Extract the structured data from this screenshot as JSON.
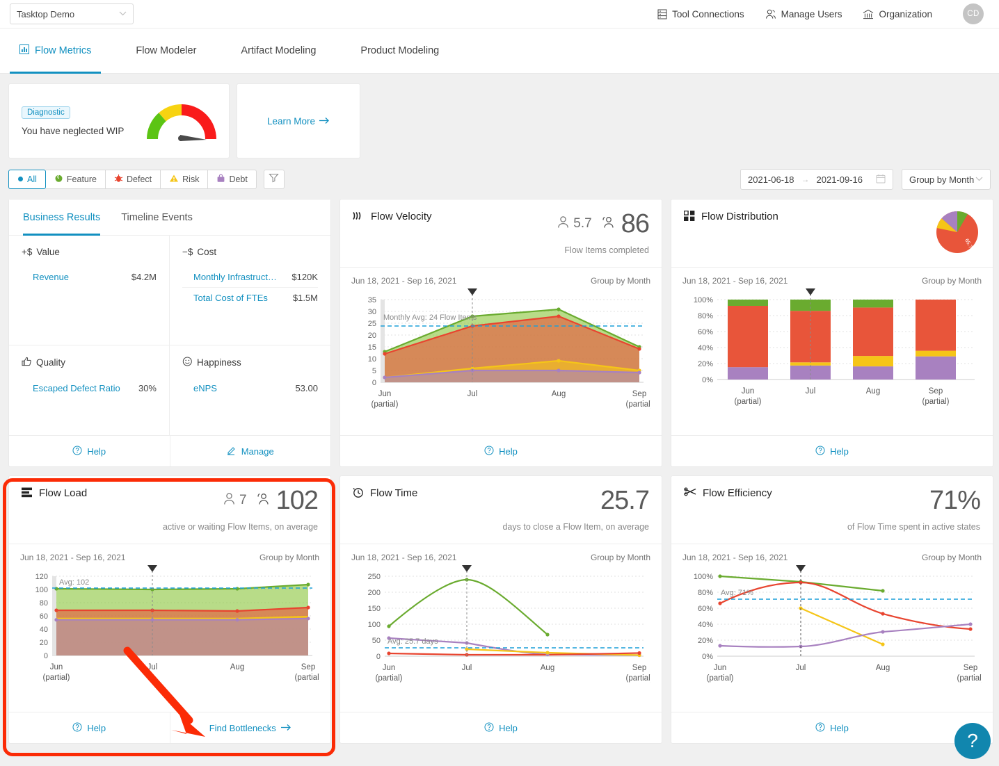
{
  "topbar": {
    "org_selector_value": "Tasktop Demo",
    "nav": [
      {
        "label": "Tool Connections",
        "icon": "list-icon"
      },
      {
        "label": "Manage Users",
        "icon": "users-icon"
      },
      {
        "label": "Organization",
        "icon": "bank-icon"
      }
    ],
    "avatar_initials": "CD"
  },
  "tabs": [
    {
      "label": "Flow Metrics",
      "icon": "bar-chart-icon",
      "active": true
    },
    {
      "label": "Flow Modeler",
      "active": false
    },
    {
      "label": "Artifact Modeling",
      "active": false
    },
    {
      "label": "Product Modeling",
      "active": false
    }
  ],
  "diagnostic": {
    "badge": "Diagnostic",
    "message": "You have neglected WIP",
    "gauge_value_pct": 88,
    "learn_more": "Learn More"
  },
  "filters": {
    "pills": [
      {
        "label": "All",
        "icon": "dot-icon",
        "selected": true,
        "color": "#1290c0"
      },
      {
        "label": "Feature",
        "icon": "feature-icon",
        "selected": false,
        "color": "#6aab2f"
      },
      {
        "label": "Defect",
        "icon": "defect-icon",
        "selected": false,
        "color": "#e8442f"
      },
      {
        "label": "Risk",
        "icon": "risk-icon",
        "selected": false,
        "color": "#f5c518"
      },
      {
        "label": "Debt",
        "icon": "debt-icon",
        "selected": false,
        "color": "#a881c0"
      }
    ],
    "funnel_icon": "filter-icon",
    "date_start": "2021-06-18",
    "date_end": "2021-09-16",
    "date_arrow": "→",
    "calendar_icon": "calendar-icon",
    "group_by": "Group by Month"
  },
  "business_results": {
    "tabs": [
      {
        "label": "Business Results",
        "active": true
      },
      {
        "label": "Timeline Events",
        "active": false
      }
    ],
    "quadrants": [
      {
        "title": "Value",
        "title_prefix": "+$",
        "icon": "plus-dollar-icon",
        "rows": [
          {
            "label": "Revenue",
            "value": "$4.2M"
          }
        ]
      },
      {
        "title": "Cost",
        "title_prefix": "−$",
        "icon": "minus-dollar-icon",
        "rows": [
          {
            "label": "Monthly Infrastruct…",
            "value": "$120K"
          },
          {
            "label": "Total Cost of FTEs",
            "value": "$1.5M"
          }
        ]
      },
      {
        "title": "Quality",
        "title_prefix": "",
        "icon": "thumbs-up-icon",
        "rows": [
          {
            "label": "Escaped Defect Ratio",
            "value": "30%"
          }
        ]
      },
      {
        "title": "Happiness",
        "title_prefix": "",
        "icon": "smiley-icon",
        "rows": [
          {
            "label": "eNPS",
            "value": "53.00"
          }
        ]
      }
    ],
    "footer": [
      {
        "label": "Help",
        "icon": "help-icon"
      },
      {
        "label": "Manage",
        "icon": "pencil-icon"
      }
    ]
  },
  "cards": {
    "flow_velocity": {
      "title": "Flow Velocity",
      "icon": "velocity-icon",
      "stat_small": "5.7",
      "stat_small_icon": "person-icon",
      "stat_big": "86",
      "stat_big_icon": "people-icon",
      "subtitle": "Flow Items completed",
      "date_range": "Jun 18, 2021 - Sep 16, 2021",
      "group_by": "Group by Month",
      "footer": [
        {
          "label": "Help",
          "icon": "help-icon"
        }
      ]
    },
    "flow_distribution": {
      "title": "Flow Distribution",
      "icon": "distribution-icon",
      "date_range": "Jun 18, 2021 - Sep 16, 2021",
      "group_by": "Group by Month",
      "pie_label": "65.7%",
      "footer": [
        {
          "label": "Help",
          "icon": "help-icon"
        }
      ]
    },
    "flow_load": {
      "title": "Flow Load",
      "icon": "load-icon",
      "stat_small": "7",
      "stat_small_icon": "person-icon",
      "stat_big": "102",
      "stat_big_icon": "people-icon",
      "subtitle": "active or waiting Flow Items, on average",
      "date_range": "Jun 18, 2021 - Sep 16, 2021",
      "group_by": "Group by Month",
      "highlighted": true,
      "footer": [
        {
          "label": "Help",
          "icon": "help-icon"
        },
        {
          "label": "Find Bottlenecks",
          "icon": "arrow-right-icon"
        }
      ]
    },
    "flow_time": {
      "title": "Flow Time",
      "icon": "clock-icon",
      "stat_big": "25.7",
      "subtitle": "days to close a Flow Item, on average",
      "date_range": "Jun 18, 2021 - Sep 16, 2021",
      "group_by": "Group by Month",
      "footer": [
        {
          "label": "Help",
          "icon": "help-icon"
        }
      ]
    },
    "flow_efficiency": {
      "title": "Flow Efficiency",
      "icon": "efficiency-icon",
      "stat_big": "71%",
      "subtitle": "of Flow Time spent in active states",
      "date_range": "Jun 18, 2021 - Sep 16, 2021",
      "group_by": "Group by Month",
      "footer": [
        {
          "label": "Help",
          "icon": "help-icon"
        }
      ]
    }
  },
  "help_fab": {
    "icon": "question-icon",
    "label": "?"
  },
  "colors": {
    "accent": "#1290c0",
    "feature": "#6aab2f",
    "defect": "#e8553a",
    "risk": "#f5c518",
    "debt": "#a881c0",
    "highlight": "#fb2b06",
    "avg_line": "#1b9fd8"
  },
  "chart_data": [
    {
      "id": "flow_velocity",
      "type": "area",
      "title": "Flow Velocity",
      "categories": [
        "Jun\n(partial)",
        "Jul",
        "Aug",
        "Sep\n(partial)"
      ],
      "ylim": [
        0,
        35
      ],
      "yticks": [
        0,
        5,
        10,
        15,
        20,
        25,
        30,
        35
      ],
      "ylabel": "",
      "annotation": "Monthly Avg: 24 Flow Items",
      "avg_line": 24,
      "grid": true,
      "series": [
        {
          "name": "Feature",
          "color": "#6aab2f",
          "values": [
            13,
            28,
            31,
            15
          ]
        },
        {
          "name": "Defect",
          "color": "#e8553a",
          "values": [
            12,
            24,
            28,
            14
          ]
        },
        {
          "name": "Risk",
          "color": "#f5c518",
          "values": [
            2,
            6,
            9,
            5
          ]
        },
        {
          "name": "Debt",
          "color": "#a881c0",
          "values": [
            2,
            5,
            5,
            4
          ]
        }
      ]
    },
    {
      "id": "flow_distribution",
      "type": "bar",
      "title": "Flow Distribution",
      "stacked": true,
      "categories": [
        "Jun\n(partial)",
        "Jul",
        "Aug",
        "Sep\n(partial)"
      ],
      "ylim": [
        0,
        100
      ],
      "yticks": [
        "0%",
        "20%",
        "40%",
        "60%",
        "80%",
        "100%"
      ],
      "grid": true,
      "series": [
        {
          "name": "Debt",
          "color": "#a881c0",
          "values": [
            15.5,
            17.5,
            16.5,
            29
          ]
        },
        {
          "name": "Risk",
          "color": "#f5c518",
          "values": [
            0,
            4,
            13,
            7
          ]
        },
        {
          "name": "Defect",
          "color": "#e8553a",
          "values": [
            76.5,
            64.5,
            60.5,
            64
          ]
        },
        {
          "name": "Feature",
          "color": "#6aab2f",
          "values": [
            8,
            14,
            10,
            0
          ]
        }
      ],
      "pie": {
        "label": "65.7%",
        "slices": [
          {
            "name": "Defect",
            "color": "#e8553a",
            "value": 65.7
          },
          {
            "name": "Debt",
            "color": "#a881c0",
            "value": 19
          },
          {
            "name": "Risk",
            "color": "#f5c518",
            "value": 7
          },
          {
            "name": "Feature",
            "color": "#6aab2f",
            "value": 8.3
          }
        ]
      }
    },
    {
      "id": "flow_load",
      "type": "area",
      "title": "Flow Load",
      "categories": [
        "Jun\n(partial)",
        "Jul",
        "Aug",
        "Sep\n(partial)"
      ],
      "ylim": [
        0,
        120
      ],
      "yticks": [
        0,
        20,
        40,
        60,
        80,
        100,
        120
      ],
      "annotation": "Avg: 102",
      "avg_line": 102,
      "grid": true,
      "series": [
        {
          "name": "Feature",
          "color": "#6aab2f",
          "values": [
            101,
            100,
            101,
            107
          ]
        },
        {
          "name": "Defect",
          "color": "#e8553a",
          "values": [
            68,
            68,
            67,
            72
          ]
        },
        {
          "name": "Risk",
          "color": "#f5c518",
          "values": [
            56,
            56,
            56,
            59
          ]
        },
        {
          "name": "Debt",
          "color": "#a881c0",
          "values": [
            54,
            54,
            54,
            56
          ]
        }
      ]
    },
    {
      "id": "flow_time",
      "type": "line",
      "title": "Flow Time",
      "categories": [
        "Jun\n(partial)",
        "Jul",
        "Aug",
        "Sep\n(partial)"
      ],
      "ylim": [
        0,
        265
      ],
      "yticks": [
        0,
        50,
        100,
        150,
        200,
        250
      ],
      "annotation": "Avg: 25.7 days",
      "avg_line": 25.7,
      "grid": true,
      "series": [
        {
          "name": "Feature",
          "color": "#6aab2f",
          "values": [
            93,
            234,
            81,
            null
          ]
        },
        {
          "name": "Debt",
          "color": "#a881c0",
          "values": [
            57,
            40,
            7,
            4
          ]
        },
        {
          "name": "Risk",
          "color": "#f5c518",
          "values": [
            null,
            20,
            11,
            4
          ]
        },
        {
          "name": "Defect",
          "color": "#e8553a",
          "values": [
            9,
            5,
            5,
            10
          ]
        }
      ]
    },
    {
      "id": "flow_efficiency",
      "type": "line",
      "title": "Flow Efficiency",
      "categories": [
        "Jun\n(partial)",
        "Jul",
        "Aug",
        "Sep\n(partial)"
      ],
      "ylim": [
        0,
        100
      ],
      "yticks": [
        "0%",
        "20%",
        "40%",
        "60%",
        "80%",
        "100%"
      ],
      "annotation": "Avg: 71%",
      "avg_line": 71,
      "grid": true,
      "series": [
        {
          "name": "Feature",
          "color": "#6aab2f",
          "values": [
            100,
            93,
            82,
            null
          ]
        },
        {
          "name": "Defect",
          "color": "#e8553a",
          "values": [
            66,
            92,
            60,
            46
          ]
        },
        {
          "name": "Risk",
          "color": "#f5c518",
          "values": [
            null,
            60,
            15,
            null
          ]
        },
        {
          "name": "Debt",
          "color": "#a881c0",
          "values": [
            13,
            12,
            30,
            40
          ]
        }
      ]
    }
  ]
}
